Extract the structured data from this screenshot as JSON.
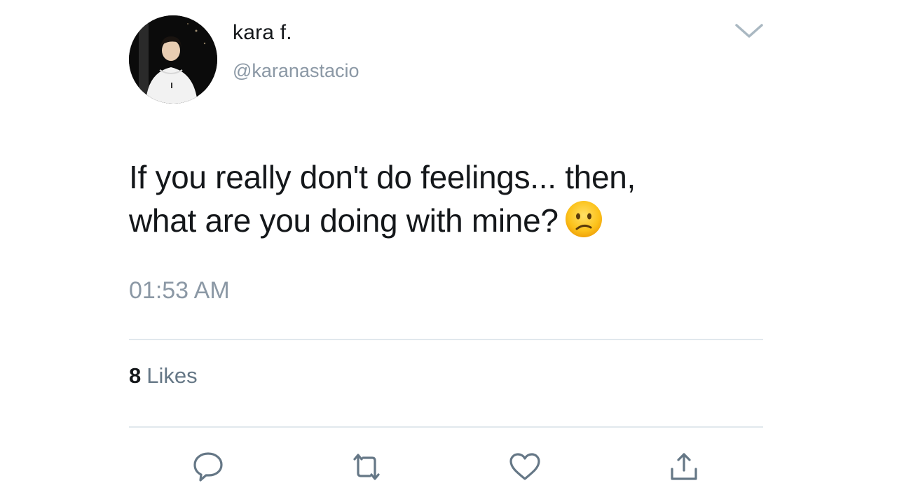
{
  "user": {
    "display_name": "kara f.",
    "handle": "@karanastacio",
    "avatar_icon": "profile-photo"
  },
  "tweet": {
    "text_line1": "If you really don't do feelings... then,",
    "text_line2": "what are you doing with mine?",
    "emoji": "slightly-frowning-face",
    "timestamp": "01:53 AM"
  },
  "stats": {
    "likes_count": "8",
    "likes_label": "Likes"
  },
  "actions": {
    "reply_icon": "reply-icon",
    "retweet_icon": "retweet-icon",
    "like_icon": "heart-icon",
    "share_icon": "share-icon"
  },
  "colors": {
    "text": "#14171a",
    "secondary": "#8b98a5",
    "divider": "#e1e8ed",
    "icon": "#657786"
  }
}
